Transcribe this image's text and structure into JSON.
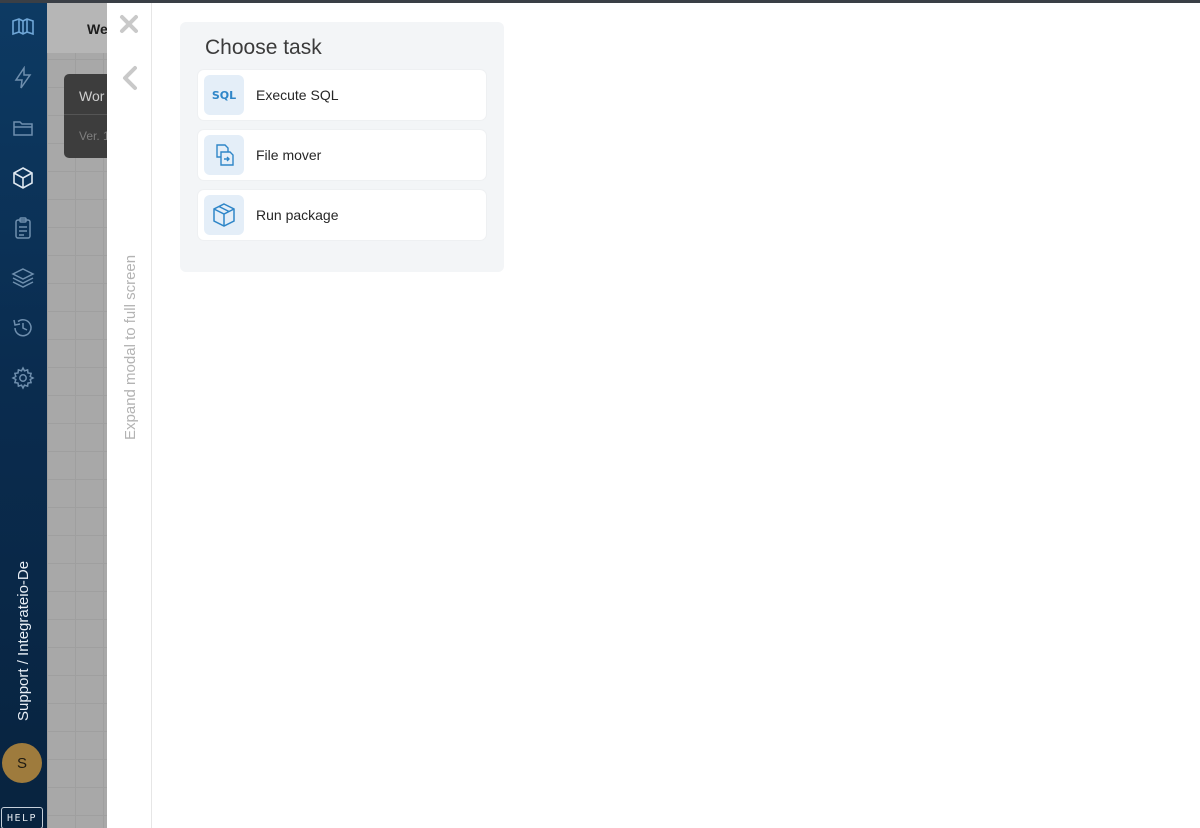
{
  "sidebar": {
    "workspace_label": "Support / Integrateio-De",
    "avatar_initial": "S",
    "help_label": "HELP",
    "nav_icons": [
      "logo-icon",
      "lightning-icon",
      "folder-icon",
      "package-icon",
      "clipboard-icon",
      "layers-icon",
      "history-icon",
      "gear-icon"
    ]
  },
  "background": {
    "tab_label": "We",
    "card_title": "Wor",
    "card_version": "Ver. 1"
  },
  "modal": {
    "expand_label": "Expand modal to full screen",
    "panel_title": "Choose task",
    "tasks": [
      {
        "label": "Execute SQL",
        "icon": "sql-icon"
      },
      {
        "label": "File mover",
        "icon": "file-mover-icon"
      },
      {
        "label": "Run package",
        "icon": "package-icon"
      }
    ]
  },
  "colors": {
    "sidebar_top": "#0d3a63",
    "sidebar_bottom": "#08233f",
    "accent_blue": "#2f86c8",
    "panel_bg": "#f3f5f7",
    "icon_bg": "#e4eef8"
  }
}
